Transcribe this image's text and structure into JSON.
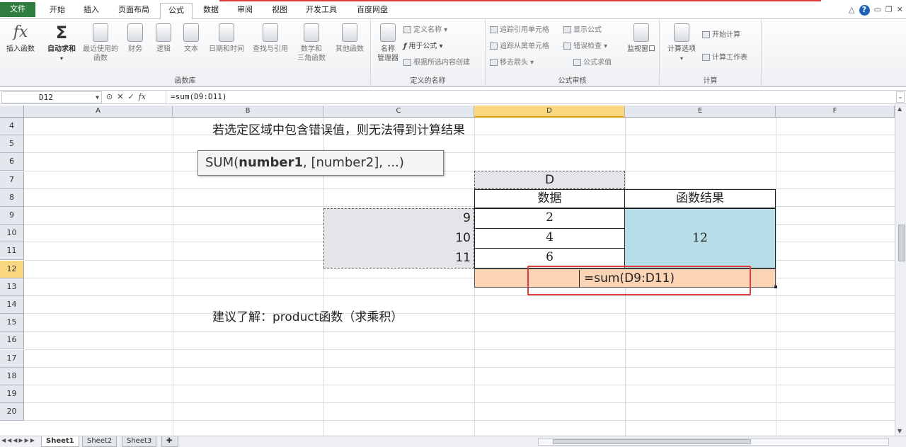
{
  "menu": {
    "tabs": [
      "文件",
      "开始",
      "插入",
      "页面布局",
      "公式",
      "数据",
      "审阅",
      "视图",
      "开发工具",
      "百度网盘"
    ],
    "active_tab": "公式",
    "help_label": "?"
  },
  "ribbon": {
    "function_library": {
      "label": "函数库",
      "insert_function": "插入函数",
      "autosum": "自动求和",
      "recently_used": "最近使用的\n函数",
      "financial": "财务",
      "logical": "逻辑",
      "text": "文本",
      "date_time": "日期和时间",
      "lookup": "查找与引用",
      "math_trig": "数学和\n三角函数",
      "more": "其他函数"
    },
    "defined_names": {
      "label": "定义的名称",
      "name_manager": "名称\n管理器",
      "define_name": "定义名称",
      "use_in_formula": "用于公式",
      "create_from_selection": "根据所选内容创建"
    },
    "formula_auditing": {
      "label": "公式审核",
      "trace_precedents": "追踪引用单元格",
      "trace_dependents": "追踪从属单元格",
      "remove_arrows": "移去箭头",
      "show_formulas": "显示公式",
      "error_checking": "错误检查",
      "evaluate_formula": "公式求值",
      "watch_window": "监视窗口"
    },
    "calculation": {
      "label": "计算",
      "calc_options": "计算选项",
      "calc_now": "开始计算",
      "calc_sheet": "计算工作表"
    }
  },
  "formula_bar": {
    "name_box": "D12",
    "formula": "=sum(D9:D11)",
    "cancel_icon": "✕",
    "enter_icon": "✓",
    "fx_label": "fx"
  },
  "columns": [
    "A",
    "B",
    "C",
    "D",
    "E",
    "F"
  ],
  "rows": [
    "4",
    "5",
    "6",
    "7",
    "8",
    "9",
    "10",
    "11",
    "12",
    "13",
    "14",
    "15",
    "16",
    "17",
    "18",
    "19",
    "20"
  ],
  "selected_column": "D",
  "selected_row": "12",
  "sheet": {
    "note_text": "若选定区域中包含错误值，则无法得到计算结果",
    "tooltip_prefix": "SUM(",
    "tooltip_bold": "number1",
    "tooltip_rest": ", [number2], ...)",
    "header_d": "D",
    "header_data": "数据",
    "header_result": "函数结果",
    "row_numbers": [
      "9",
      "10",
      "11"
    ],
    "data_values": [
      "2",
      "4",
      "6"
    ],
    "result_value": "12",
    "formula_in_cell": "=sum(D9:D11)",
    "suggest_text": "建议了解：product函数（求乘积）"
  },
  "sheets": [
    "Sheet1",
    "Sheet2",
    "Sheet3"
  ],
  "active_sheet": "Sheet1",
  "colors": {
    "file_tab": "#2f7d3f",
    "header_fill": "#e3e5e8",
    "result_fill": "#b7dde8",
    "formula_cell_fill": "#fbd4b4",
    "highlight_red": "#e23b3b",
    "selected_header": "#f9d77e"
  }
}
